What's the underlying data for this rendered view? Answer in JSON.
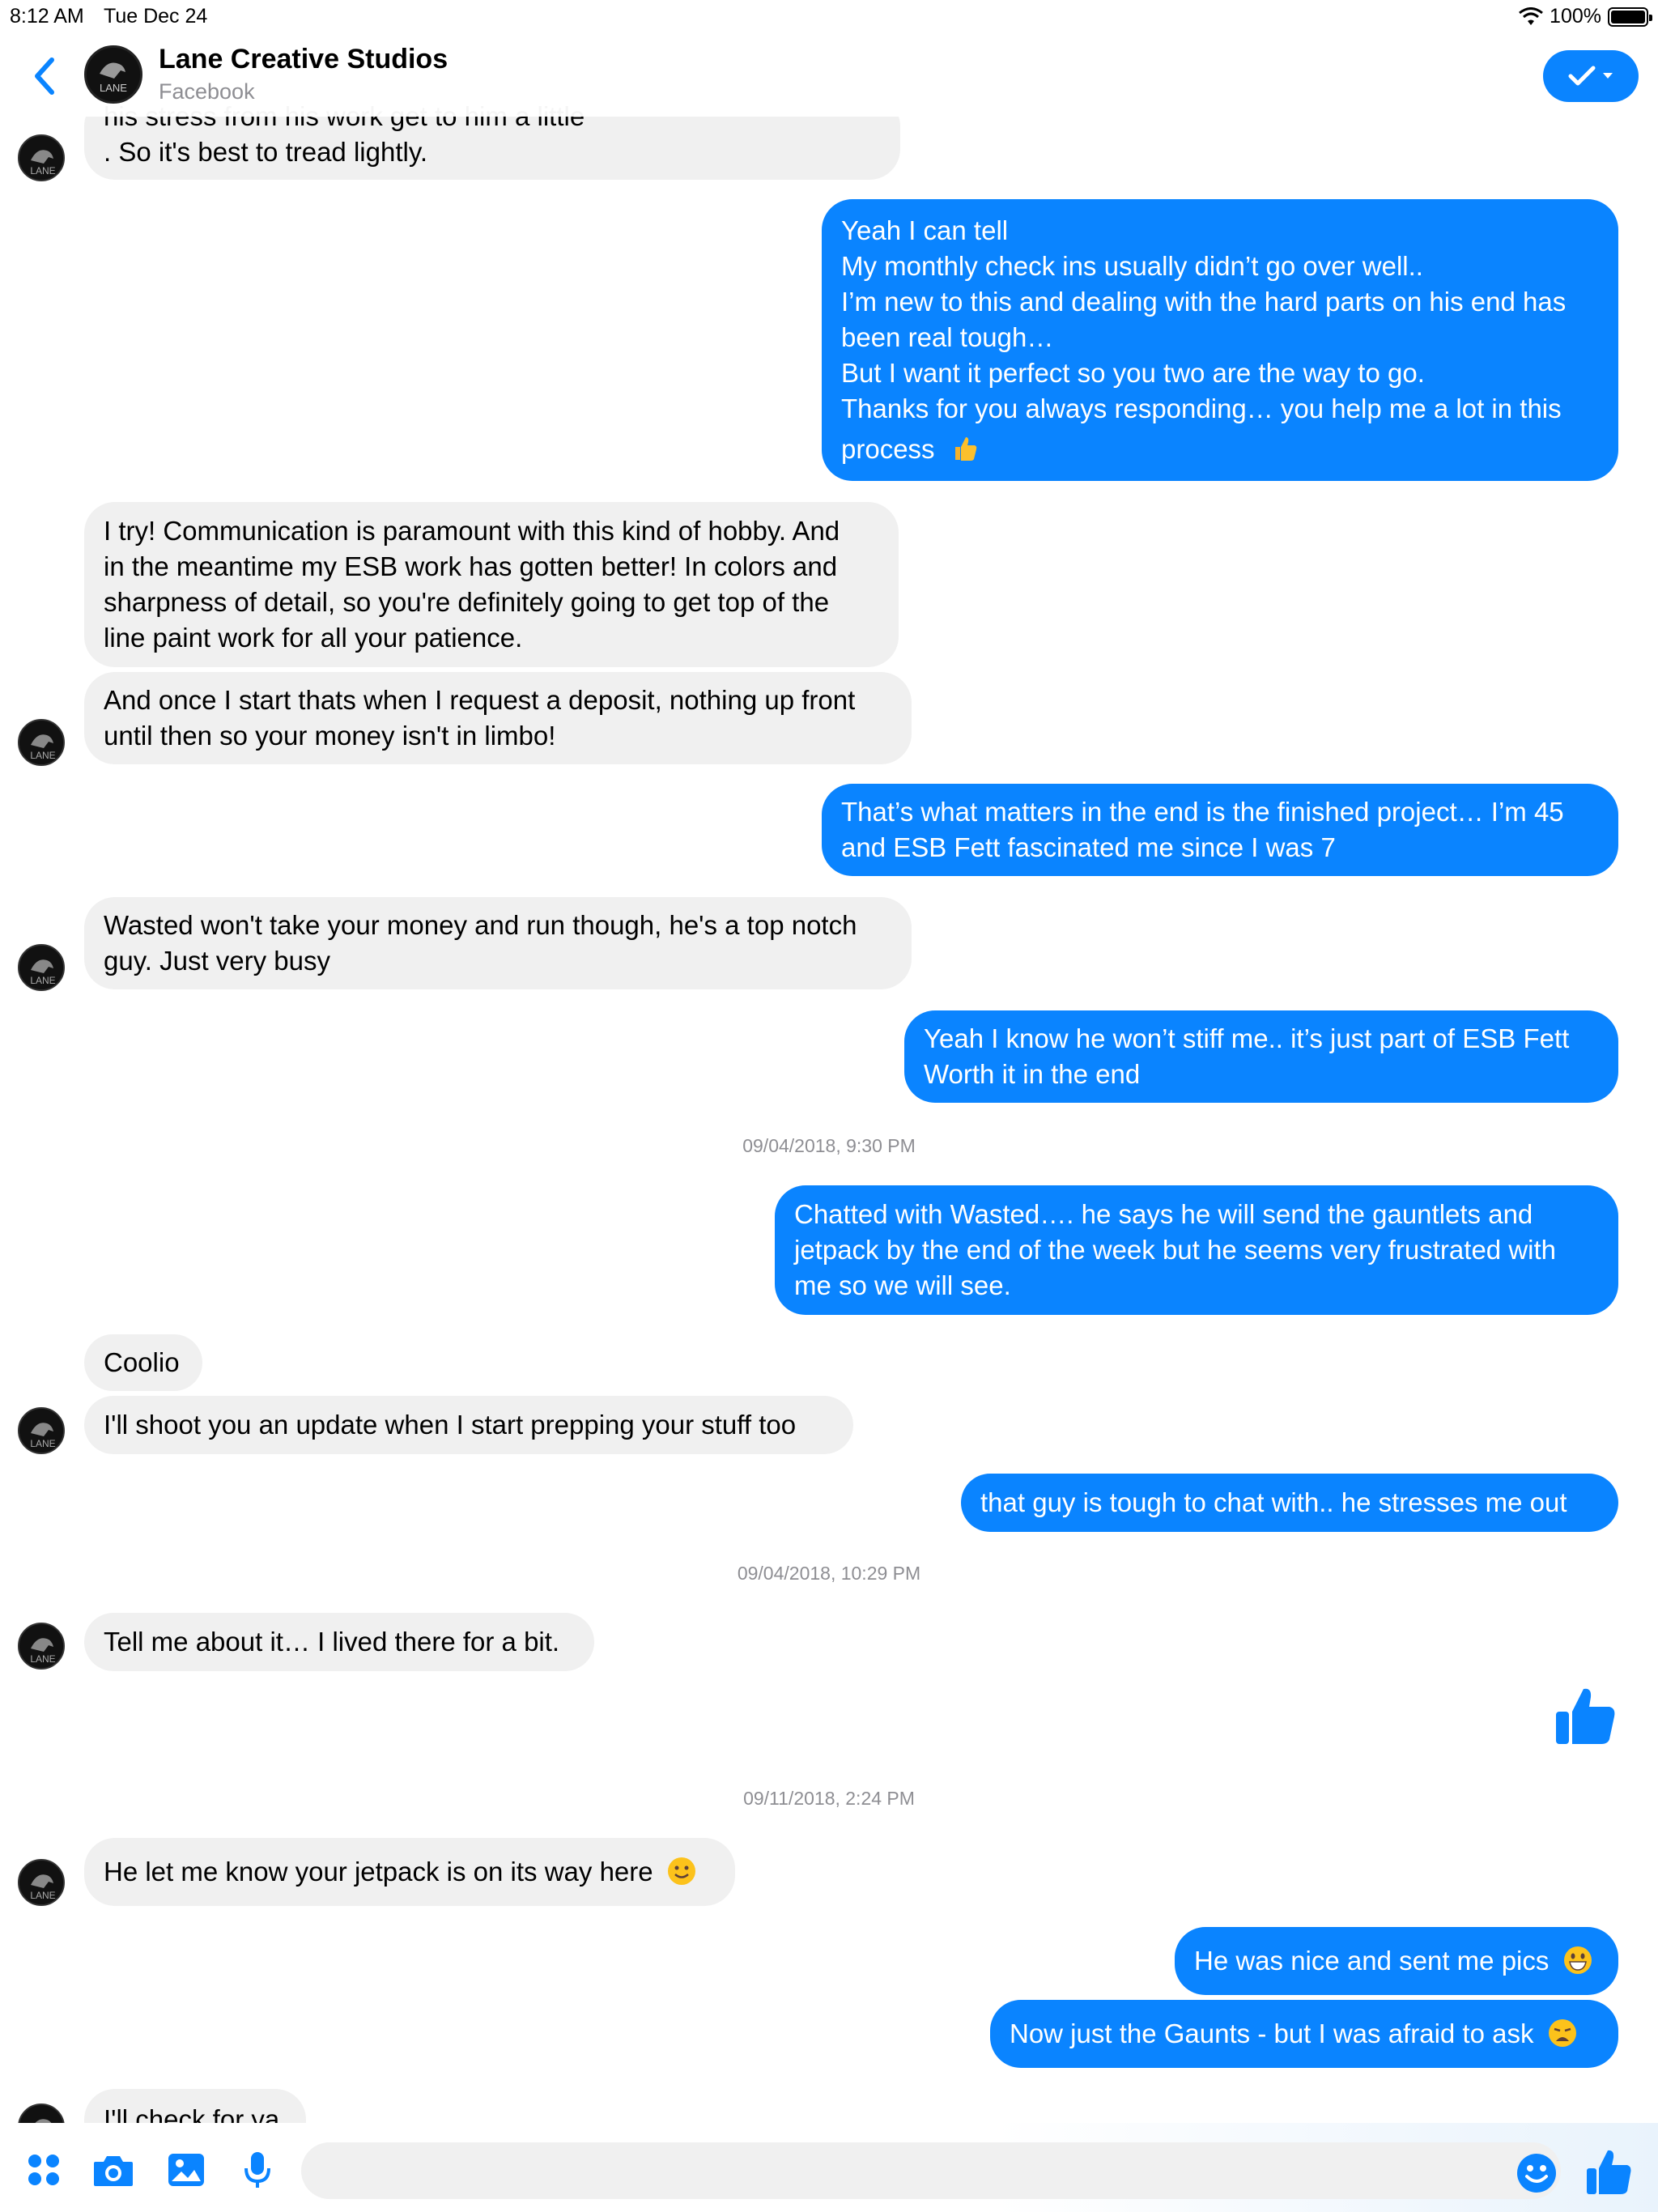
{
  "status_bar": {
    "time": "8:12 AM",
    "date": "Tue Dec 24",
    "battery": "100%"
  },
  "header": {
    "title": "Lane Creative Studios",
    "subtitle": "Facebook",
    "avatar_text": "LANE"
  },
  "messages": [
    {
      "lines": [
        "his stress from his work get to him a little",
        ". So it's best to tread lightly."
      ]
    },
    {
      "lines": [
        "Yeah I can tell",
        "My monthly check ins usually didn’t go over well..",
        "I’m new to this and dealing with the hard parts on his end has",
        "been real tough…",
        "But I want it perfect so you two are the way to go.",
        "Thanks for you always responding… you help me a lot in this",
        "process"
      ],
      "emoji": "thumbs-up-emoji"
    },
    {
      "lines": [
        "I try! Communication is paramount with this kind of hobby. And",
        "in the meantime my ESB work has gotten better! In colors and",
        "sharpness of detail, so you're definitely going to get top of the",
        "line paint work for all your patience."
      ]
    },
    {
      "lines": [
        "And once I start thats when I request a deposit, nothing up front",
        "until then so your money isn't in limbo!"
      ]
    },
    {
      "lines": [
        "That’s what matters in the end is the finished project… I’m 45",
        "and ESB Fett fascinated me since I was 7"
      ]
    },
    {
      "lines": [
        "Wasted won't take your money and run though, he's a top notch",
        "guy. Just very busy"
      ]
    },
    {
      "lines": [
        "Yeah I know he won’t stiff me.. it’s just part of ESB Fett",
        "Worth it in the end"
      ]
    },
    {
      "lines": [
        "Chatted with Wasted…. he says he will send the gauntlets and",
        "jetpack by the end of the week but he seems very frustrated with",
        "me so we will see."
      ]
    },
    {
      "lines": [
        "Coolio"
      ]
    },
    {
      "lines": [
        "I'll shoot you an update when I start prepping your stuff too"
      ]
    },
    {
      "lines": [
        "that guy is tough to chat with.. he stresses me out"
      ]
    },
    {
      "lines": [
        "Tell me about it… I lived there for a bit."
      ]
    },
    {
      "lines": [
        "He let me know your jetpack is on its way here"
      ],
      "emoji": "slight-smile-emoji"
    },
    {
      "lines": [
        "He was nice and sent me pics"
      ],
      "emoji": "grin-emoji"
    },
    {
      "lines": [
        "Now just the Gaunts - but I was afraid to ask"
      ],
      "emoji": "weary-face-emoji"
    },
    {
      "lines": [
        "I'll check for ya"
      ]
    }
  ],
  "timestamps": [
    "09/04/2018, 9:30 PM",
    "09/04/2018, 10:29 PM",
    "09/11/2018, 2:24 PM"
  ],
  "composer": {
    "placeholder": ""
  },
  "colors": {
    "accent": "#0a84ff",
    "incoming": "#f0f0f0",
    "timestamp": "#8e8e93"
  }
}
